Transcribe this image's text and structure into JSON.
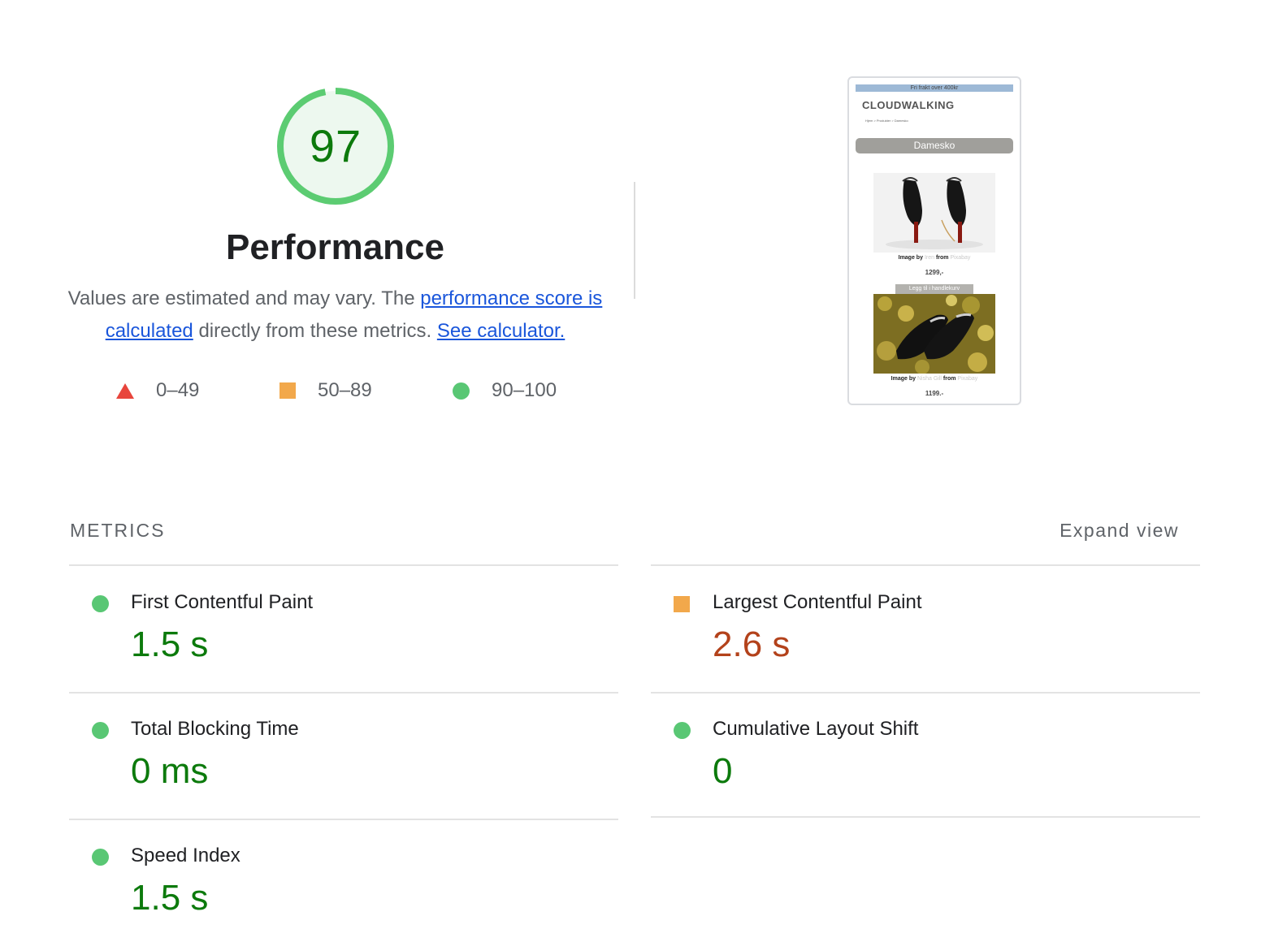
{
  "score": {
    "value": "97",
    "fraction": 0.97,
    "title": "Performance",
    "colors": {
      "ring": "#5ccc72",
      "fill": "#edf8ef",
      "text": "#0c7a0c"
    }
  },
  "description": {
    "text_before": "Values are estimated and may vary. The ",
    "link1": "performance score is calculated",
    "text_middle": " directly from these metrics. ",
    "link2": "See calculator."
  },
  "legend": [
    {
      "shape": "triangle",
      "range": "0–49",
      "color": "#e8453c"
    },
    {
      "shape": "square",
      "range": "50–89",
      "color": "#f2a84b"
    },
    {
      "shape": "circle",
      "range": "90–100",
      "color": "#59c774"
    }
  ],
  "thumbnail": {
    "banner": "Fri frakt over 400kr",
    "logo": "CLOUDWALKING",
    "breadcrumb": "Hjem > Produkter > Damesko",
    "category": "Damesko",
    "product1": {
      "credit_prefix": "Image by",
      "credit_author": "Iren",
      "credit_mid": "from",
      "credit_site": "Pixabay",
      "price": "1299,-",
      "cart_button": "Legg til i handlekurv"
    },
    "product2": {
      "credit_prefix": "Image by",
      "credit_author": "Nisha Gill",
      "credit_mid": "from",
      "credit_site": "Pixabay",
      "price": "1199.-"
    }
  },
  "metrics_section": {
    "heading": "METRICS",
    "expand_label": "Expand view"
  },
  "metrics": {
    "fcp": {
      "label": "First Contentful Paint",
      "value": "1.5 s",
      "status": "good"
    },
    "lcp": {
      "label": "Largest Contentful Paint",
      "value": "2.6 s",
      "status": "average"
    },
    "tbt": {
      "label": "Total Blocking Time",
      "value": "0 ms",
      "status": "good"
    },
    "cls": {
      "label": "Cumulative Layout Shift",
      "value": "0",
      "status": "good"
    },
    "si": {
      "label": "Speed Index",
      "value": "1.5 s",
      "status": "good"
    }
  }
}
